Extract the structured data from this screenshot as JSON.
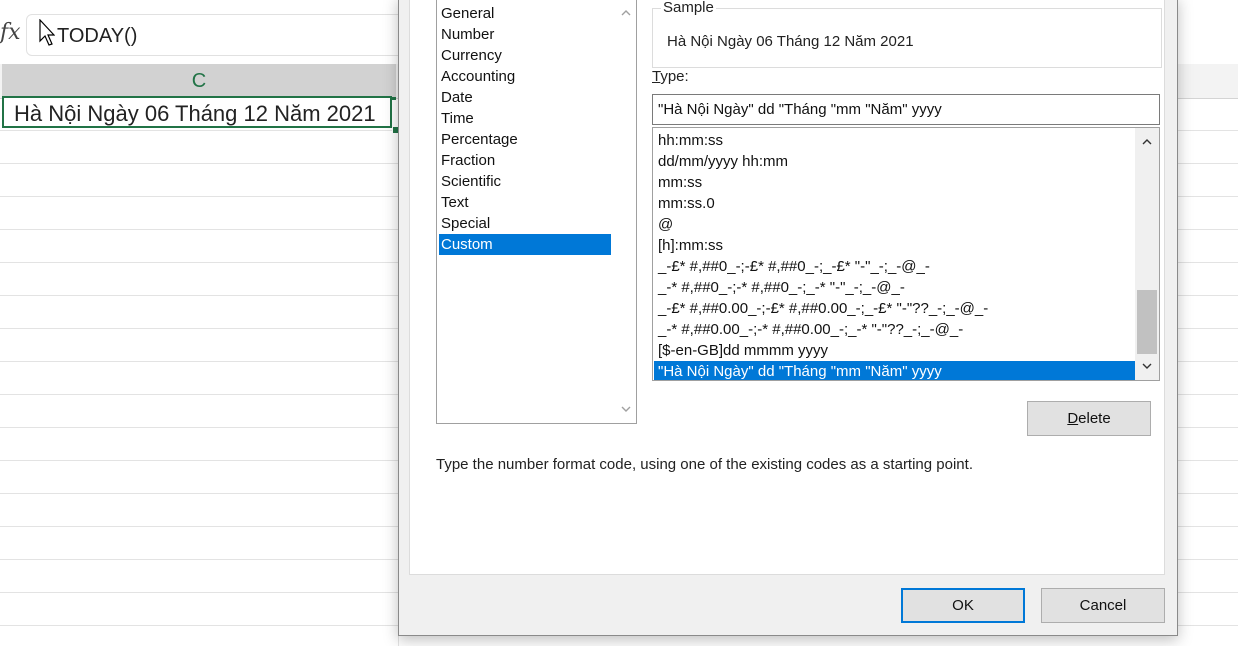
{
  "formula_bar": {
    "fx_label": "fx",
    "formula": "TODAY()"
  },
  "sheet": {
    "column_label": "C",
    "active_cell_value": "Hà Nội Ngày 06 Tháng 12 Năm 2021"
  },
  "dialog": {
    "categories": [
      {
        "label": "General"
      },
      {
        "label": "Number"
      },
      {
        "label": "Currency"
      },
      {
        "label": "Accounting"
      },
      {
        "label": "Date"
      },
      {
        "label": "Time"
      },
      {
        "label": "Percentage"
      },
      {
        "label": "Fraction"
      },
      {
        "label": "Scientific"
      },
      {
        "label": "Text"
      },
      {
        "label": "Special"
      },
      {
        "label": "Custom"
      }
    ],
    "selected_category": "Custom",
    "sample_label": "Sample",
    "sample_value": "Hà Nội Ngày 06 Tháng 12 Năm 2021",
    "type_label_prefix": "T",
    "type_label_rest": "ype:",
    "type_value": "\"Hà Nội Ngày\" dd \"Tháng \"mm \"Năm\" yyyy",
    "format_codes": [
      {
        "label": "hh:mm:ss"
      },
      {
        "label": "dd/mm/yyyy hh:mm"
      },
      {
        "label": "mm:ss"
      },
      {
        "label": "mm:ss.0"
      },
      {
        "label": "@"
      },
      {
        "label": "[h]:mm:ss"
      },
      {
        "label": "_-£* #,##0_-;-£* #,##0_-;_-£* \"-\"_-;_-@_-"
      },
      {
        "label": "_-* #,##0_-;-* #,##0_-;_-* \"-\"_-;_-@_-"
      },
      {
        "label": "_-£* #,##0.00_-;-£* #,##0.00_-;_-£* \"-\"??_-;_-@_-"
      },
      {
        "label": "_-* #,##0.00_-;-* #,##0.00_-;_-* \"-\"??_-;_-@_-"
      },
      {
        "label": "[$-en-GB]dd mmmm yyyy"
      },
      {
        "label": "\"Hà Nội Ngày\" dd \"Tháng \"mm \"Năm\" yyyy"
      }
    ],
    "selected_format_index": 11,
    "delete_label_prefix": "D",
    "delete_label_rest": "elete",
    "help_text": "Type the number format code, using one of the existing codes as a starting point.",
    "ok_label": "OK",
    "cancel_label": "Cancel"
  },
  "colors": {
    "accent": "#217346",
    "selection": "#0078d7"
  }
}
